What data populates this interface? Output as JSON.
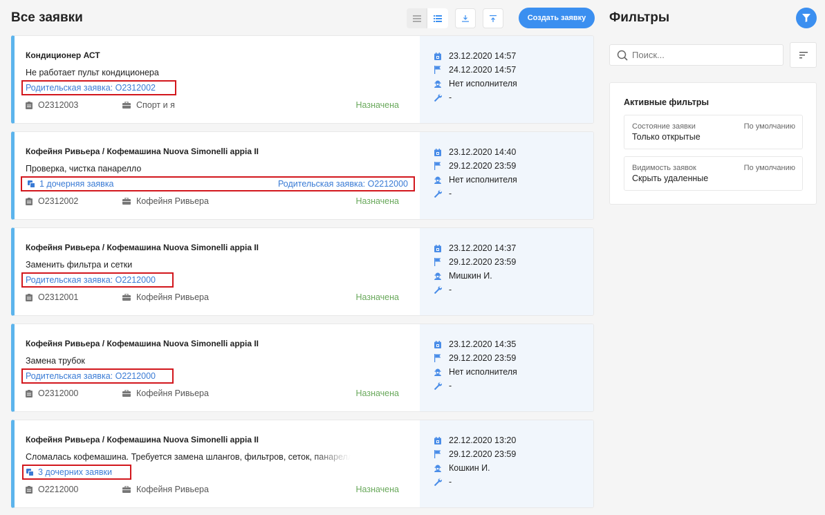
{
  "header": {
    "title": "Все заявки",
    "create_button": "Создать заявку"
  },
  "colors": {
    "accent": "#3b8ff0",
    "card_border": "#5cb4ec",
    "link": "#3a7bd5",
    "status_assigned": "#68a85a",
    "highlight_box": "#d2161c",
    "info_icon": "#4a8de8"
  },
  "cards": [
    {
      "title": "Кондиционер АСТ",
      "description": "Не работает пульт кондиционера",
      "child_link": "",
      "parent_link": "Родительская заявка: О2312002",
      "number": "О2312003",
      "client": "Спорт и я",
      "status": "Назначена",
      "created": "23.12.2020 14:57",
      "deadline": "24.12.2020 14:57",
      "executor": "Нет исполнителя",
      "work": "-"
    },
    {
      "title": "Кофейня Ривьера / Кофемашина Nuova Simonelli appia II",
      "description": "Проверка, чистка панарелло",
      "child_link": "1 дочерняя заявка",
      "parent_link": "Родительская заявка: О2212000",
      "number": "О2312002",
      "client": "Кофейня Ривьера",
      "status": "Назначена",
      "created": "23.12.2020 14:40",
      "deadline": "29.12.2020 23:59",
      "executor": "Нет исполнителя",
      "work": "-"
    },
    {
      "title": "Кофейня Ривьера / Кофемашина Nuova Simonelli appia II",
      "description": "Заменить фильтра и сетки",
      "child_link": "",
      "parent_link": "Родительская заявка: О2212000",
      "number": "О2312001",
      "client": "Кофейня Ривьера",
      "status": "Назначена",
      "created": "23.12.2020 14:37",
      "deadline": "29.12.2020 23:59",
      "executor": "Мишкин И.",
      "work": "-"
    },
    {
      "title": "Кофейня Ривьера / Кофемашина Nuova Simonelli appia II",
      "description": "Замена трубок",
      "child_link": "",
      "parent_link": "Родительская заявка: О2212000",
      "number": "О2312000",
      "client": "Кофейня Ривьера",
      "status": "Назначена",
      "created": "23.12.2020 14:35",
      "deadline": "29.12.2020 23:59",
      "executor": "Нет исполнителя",
      "work": "-"
    },
    {
      "title": "Кофейня Ривьера / Кофемашина Nuova Simonelli appia II",
      "description": "Сломалась кофемашина. Требуется замена шлангов, фильтров, сеток, панарелло",
      "child_link": "3 дочерних заявки",
      "parent_link": "",
      "number": "О2212000",
      "client": "Кофейня Ривьера",
      "status": "Назначена",
      "created": "22.12.2020 13:20",
      "deadline": "29.12.2020 23:59",
      "executor": "Кошкин И.",
      "work": "-"
    }
  ],
  "filters": {
    "title": "Фильтры",
    "search_placeholder": "Поиск...",
    "active_title": "Активные фильтры",
    "items": [
      {
        "label": "Состояние заявки",
        "default": "По умолчанию",
        "value": "Только открытые"
      },
      {
        "label": "Видимость заявок",
        "default": "По умолчанию",
        "value": "Скрыть удаленные"
      }
    ]
  },
  "icons": {
    "view_list_compact": "list-compact-icon",
    "view_list_detailed": "list-detailed-icon",
    "download": "download-icon",
    "upload": "upload-icon",
    "filter": "funnel-icon",
    "search": "search-icon",
    "sort": "sort-icon",
    "number": "clipboard-icon",
    "client": "briefcase-icon",
    "created": "calendar-icon",
    "deadline": "flag-icon",
    "executor": "worker-icon",
    "work": "wrench-icon",
    "child": "copy-icon"
  }
}
